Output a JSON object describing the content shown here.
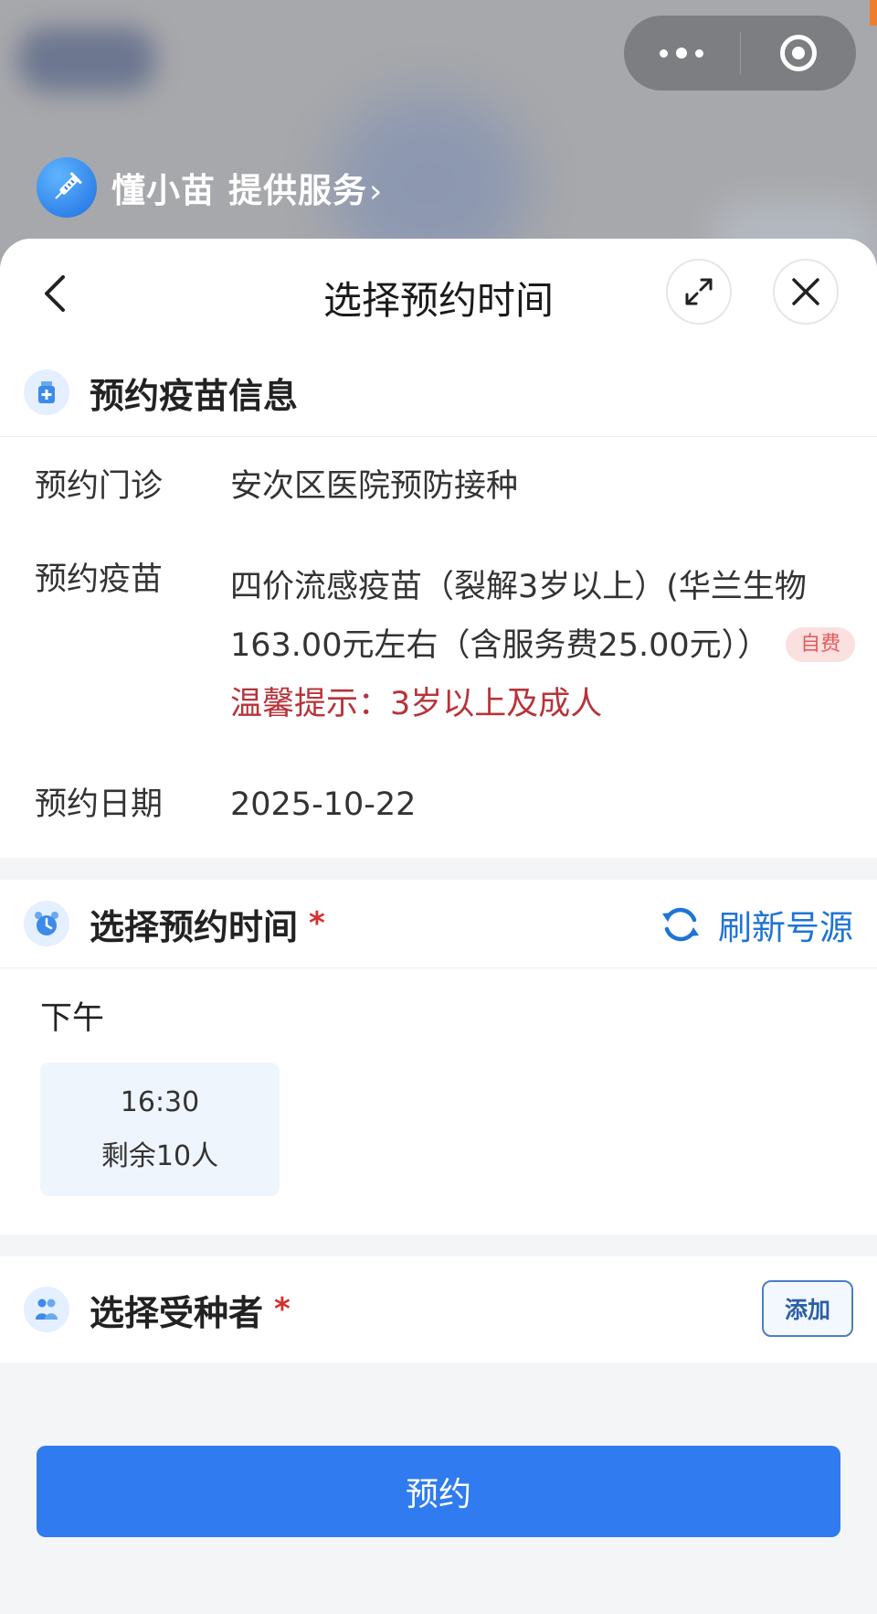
{
  "capsule": {
    "more_icon": "more-dots-icon",
    "target_icon": "target-icon"
  },
  "provider": {
    "name": "懂小苗",
    "service": "提供服务",
    "chevron": "›"
  },
  "sheet": {
    "title": "选择预约时间",
    "back_icon": "back-chevron-icon",
    "expand_icon": "expand-arrows-icon",
    "close_icon": "close-icon"
  },
  "vaccine_info": {
    "title": "预约疫苗信息",
    "clinic_label": "预约门诊",
    "clinic_value": "安次区医院预防接种",
    "vaccine_label": "预约疫苗",
    "vaccine_line1": "四价流感疫苗（裂解3岁以上）(华兰生物",
    "vaccine_line2": "163.00元左右（含服务费25.00元））",
    "self_pay_tag": "自费",
    "tip": "温馨提示：3岁以上及成人",
    "date_label": "预约日期",
    "date_value": "2025-10-22"
  },
  "time_select": {
    "title": "选择预约时间",
    "required_mark": "*",
    "refresh_label": "刷新号源",
    "period": "下午",
    "slots": [
      {
        "time": "16:30",
        "remaining": "剩余10人"
      }
    ]
  },
  "recipient": {
    "title": "选择受种者",
    "required_mark": "*",
    "add_label": "添加"
  },
  "book_button": "预约",
  "colors": {
    "primary": "#2f7bef",
    "link": "#1f74d6",
    "warning_red": "#b8333a",
    "required_red": "#d6302e"
  }
}
